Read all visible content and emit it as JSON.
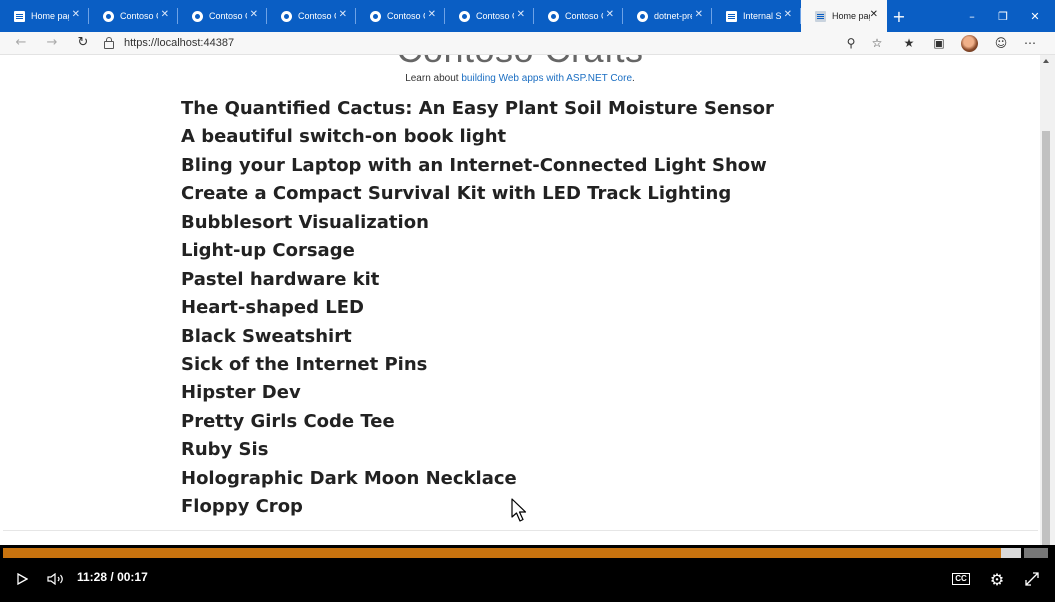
{
  "tabs": [
    {
      "label": "Home page",
      "icon": "document-icon",
      "active": false
    },
    {
      "label": "Contoso Crafts",
      "icon": "github-icon",
      "active": false
    },
    {
      "label": "Contoso Crafts",
      "icon": "github-icon",
      "active": false
    },
    {
      "label": "Contoso Crafts",
      "icon": "github-icon",
      "active": false
    },
    {
      "label": "Contoso Crafts",
      "icon": "github-icon",
      "active": false
    },
    {
      "label": "Contoso Crafts",
      "icon": "github-icon",
      "active": false
    },
    {
      "label": "Contoso Crafts",
      "icon": "github-icon",
      "active": false
    },
    {
      "label": "dotnet-presentations",
      "icon": "github-icon",
      "active": false
    },
    {
      "label": "Internal Server",
      "icon": "document-icon",
      "active": false
    },
    {
      "label": "Home page",
      "icon": "document-icon",
      "active": true
    }
  ],
  "address_bar": {
    "url": "https://localhost:44387"
  },
  "page": {
    "title": "Contoso Crafts",
    "learn_prefix": "Learn about ",
    "learn_link": "building Web apps with ASP.NET Core",
    "learn_suffix": ".",
    "products": [
      "The Quantified Cactus: An Easy Plant Soil Moisture Sensor",
      "A beautiful switch-on book light",
      "Bling your Laptop with an Internet-Connected Light Show",
      "Create a Compact Survival Kit with LED Track Lighting",
      "Bubblesort Visualization",
      "Light-up Corsage",
      "Pastel hardware kit",
      "Heart-shaped LED",
      "Black Sweatshirt",
      "Sick of the Internet Pins",
      "Hipster Dev",
      "Pretty Girls Code Tee",
      "Ruby Sis",
      "Holographic Dark Moon Necklace",
      "Floppy Crop"
    ]
  },
  "player": {
    "current_time": "11:28",
    "separator": "/",
    "duration": "00:17",
    "progress_fraction": 0.98,
    "accent_color": "#c8730f",
    "captions_label": "CC"
  },
  "colors": {
    "tabstrip": "#0a5ec4",
    "link": "#1b6ec2"
  }
}
